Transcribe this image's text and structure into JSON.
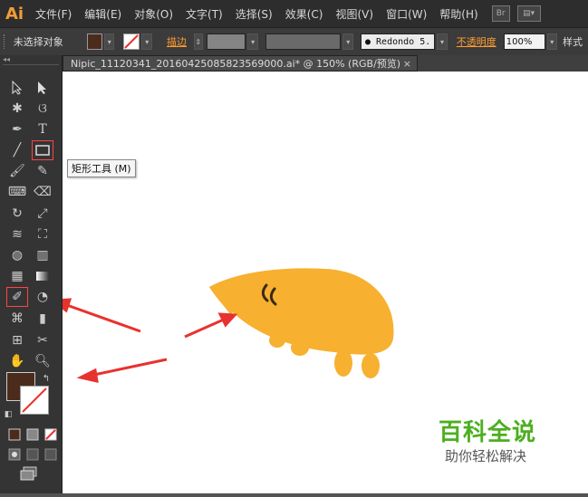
{
  "app": {
    "logo": "Ai"
  },
  "menu": [
    "文件(F)",
    "编辑(E)",
    "对象(O)",
    "文字(T)",
    "选择(S)",
    "效果(C)",
    "视图(V)",
    "窗口(W)",
    "帮助(H)"
  ],
  "menu_buttons": {
    "bridge": "Br",
    "arrange": "▤▾"
  },
  "control": {
    "selection_status": "未选择对象",
    "stroke_label": "描边",
    "brush_value": "Redondo 5.",
    "opacity_label": "不透明度",
    "opacity_value": "100%",
    "style_label": "样式"
  },
  "document": {
    "tab_title": "Nipic_11120341_20160425085823569000.ai* @ 150% (RGB/预览)",
    "close": "×"
  },
  "tooltip": "矩形工具 (M)",
  "colors": {
    "fill": "#4b2c1c",
    "creature": "#f7b02f",
    "arrow": "#e8322e",
    "watermark": "#4caf20"
  },
  "watermark": {
    "title": "百科全说",
    "subtitle": "助你轻松解决"
  },
  "tools": {
    "collapse": "◂◂"
  }
}
